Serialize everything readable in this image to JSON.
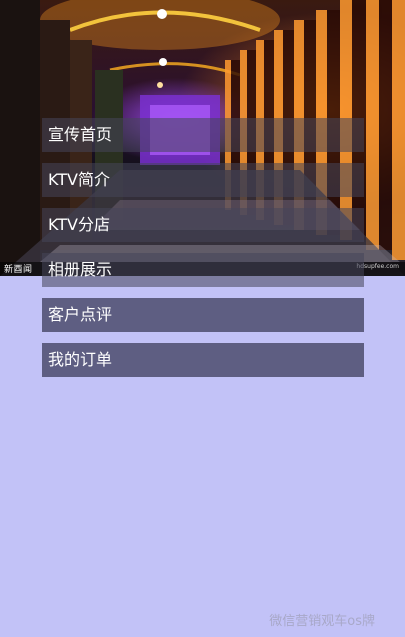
{
  "banner": {
    "caption_left": "新酉闻",
    "caption_right": "hdsupfee.com"
  },
  "menu": {
    "items": [
      {
        "label": "宣传首页"
      },
      {
        "label": "KTV简介"
      },
      {
        "label": "KTV分店"
      },
      {
        "label": "相册展示"
      },
      {
        "label": "客户点评"
      },
      {
        "label": "我的订单"
      }
    ]
  },
  "watermark": "微信营销观车os牌"
}
